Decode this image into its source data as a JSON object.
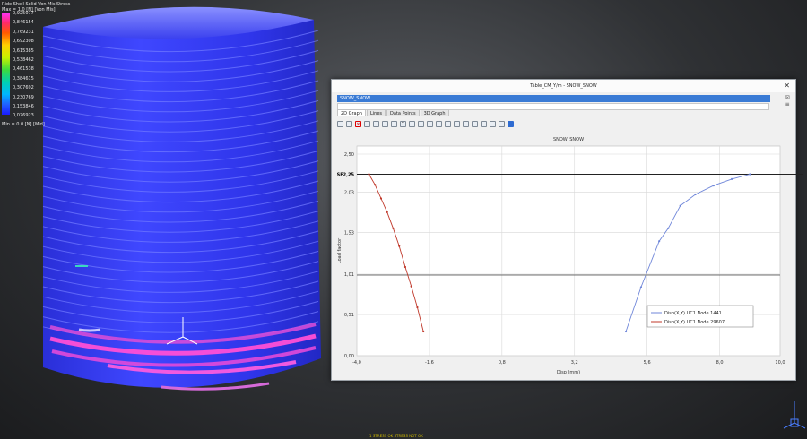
{
  "viewport": {
    "legend_title_1": "Ride Shell Solid Von Mis Stress",
    "legend_title_2": "Max = 1.0 [N] [Von Mis]",
    "legend_ticks": [
      "0,925077",
      "0,846154",
      "0,769231",
      "0,692308",
      "0,615385",
      "0,538462",
      "0,461538",
      "0,384615",
      "0,307692",
      "0,230769",
      "0,153846",
      "0,076923"
    ],
    "legend_min": "Min = 0.0 [N] [Mid]",
    "bottom_note": "1 STRESS OK STRESS NOT OK"
  },
  "dialog": {
    "title": "Table_CM_Y/m - SNOW_SNOW",
    "selection": "SNOW_SNOW",
    "tabs": [
      "2D Graph",
      "Lines",
      "Data Points",
      "3D Graph"
    ],
    "close_glyph": "✕"
  },
  "chart_data": {
    "type": "line",
    "title": "SNOW_SNOW",
    "xlabel": "Disp (mm)",
    "ylabel": "Load factor",
    "xlim": [
      -4.0,
      10.0
    ],
    "ylim": [
      0.0,
      2.6
    ],
    "x_ticks": [
      "-4,0",
      "-1,6",
      "0,8",
      "3,2",
      "5,6",
      "8,0",
      "10,0"
    ],
    "x_tick_values": [
      -4.0,
      -1.6,
      0.8,
      3.2,
      5.6,
      8.0,
      10.0
    ],
    "y_ticks": [
      "2,50",
      "2,03",
      "1,53",
      "1,01",
      "0,51",
      "0,00"
    ],
    "y_tick_values": [
      2.5,
      2.03,
      1.53,
      1.01,
      0.51,
      0.0
    ],
    "reference_label": "SF2,25",
    "reference_value": 2.25,
    "midline_value": 1.0,
    "series": [
      {
        "name": "Disp(X,Y) UC1 Node 1441",
        "color": "#6f86d9",
        "x": [
          4.9,
          5.4,
          6.0,
          6.3,
          6.7,
          7.2,
          7.8,
          8.4,
          9.0
        ],
        "y": [
          0.3,
          0.85,
          1.42,
          1.58,
          1.86,
          2.0,
          2.11,
          2.19,
          2.25
        ]
      },
      {
        "name": "Disp(X,Y) UC1 Node 29607",
        "color": "#c0392b",
        "x": [
          -3.6,
          -3.4,
          -3.2,
          -3.0,
          -2.8,
          -2.6,
          -2.4,
          -2.2,
          -2.0,
          -1.8
        ],
        "y": [
          2.25,
          2.12,
          1.95,
          1.78,
          1.58,
          1.36,
          1.1,
          0.86,
          0.6,
          0.3
        ]
      }
    ]
  }
}
